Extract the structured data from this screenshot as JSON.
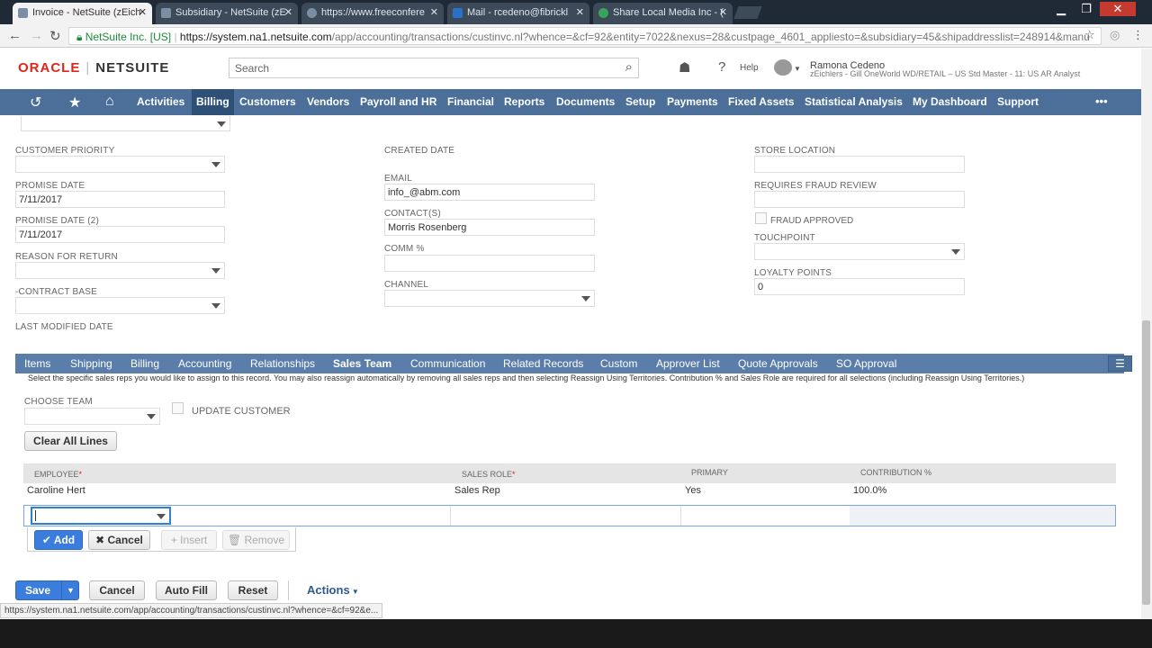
{
  "browser": {
    "tabs": [
      {
        "title": "Invoice - NetSuite (zEich",
        "active": true
      },
      {
        "title": "Subsidiary - NetSuite (zE",
        "active": false
      },
      {
        "title": "https://www.freeconfere",
        "active": false
      },
      {
        "title": "Mail - rcedeno@fibrickl",
        "active": false
      },
      {
        "title": "Share Local Media Inc - (",
        "active": false
      }
    ],
    "url_org": "NetSuite Inc. [US]",
    "url_host": "https://system.na1.netsuite.com",
    "url_path": "/app/accounting/transactions/custinvc.nl?whence=&cf=92&entity=7022&nexus=28&custpage_4601_appliesto=&subsidiary=45&shipaddresslist=248914&manu",
    "status_url": "https://system.na1.netsuite.com/app/accounting/transactions/custinvc.nl?whence=&cf=92&e..."
  },
  "header": {
    "logo_oracle": "ORACLE",
    "logo_netsuite": "NETSUITE",
    "search_placeholder": "Search",
    "help_label": "Help",
    "user_name": "Ramona Cedeno",
    "user_role": "zEichlers - Gill OneWorld WD/RETAIL – US Std Master - 11: US AR Analyst"
  },
  "nav": {
    "items": [
      "Activities",
      "Billing",
      "Customers",
      "Vendors",
      "Payroll and HR",
      "Financial",
      "Reports",
      "Documents",
      "Setup",
      "Payments",
      "Fixed Assets",
      "Statistical Analysis",
      "My Dashboard",
      "Support"
    ],
    "selected": "Billing",
    "more": "•••"
  },
  "form": {
    "col1": {
      "customer_priority": "CUSTOMER PRIORITY",
      "promise_date_label": "PROMISE DATE",
      "promise_date_value": "7/11/2017",
      "promise_date2_label": "PROMISE DATE (2)",
      "promise_date2_value": "7/11/2017",
      "reason_for_return": "REASON FOR RETURN",
      "contract_base": "-CONTRACT BASE",
      "last_modified": "LAST MODIFIED DATE"
    },
    "col2": {
      "created_date": "CREATED DATE",
      "email_label": "EMAIL",
      "email_value": "info_@abm.com",
      "contacts_label": "CONTACT(S)",
      "contacts_value": "Morris Rosenberg",
      "comm_label": "COMM %",
      "channel_label": "CHANNEL"
    },
    "col3": {
      "store_location": "STORE LOCATION",
      "requires_fraud": "REQUIRES FRAUD REVIEW",
      "fraud_approved": "FRAUD APPROVED",
      "touchpoint": "TOUCHPOINT",
      "loyalty_label": "LOYALTY POINTS",
      "loyalty_value": "0"
    }
  },
  "subtabs": {
    "items": [
      "Items",
      "Shipping",
      "Billing",
      "Accounting",
      "Relationships",
      "Sales Team",
      "Communication",
      "Related Records",
      "Custom",
      "Approver List",
      "Quote Approvals",
      "SO Approval"
    ],
    "selected": "Sales Team",
    "menu_icon": "list-icon"
  },
  "sales_team": {
    "help_text": "Select the specific sales reps you would like to assign to this record. You may also reassign automatically by removing all sales reps and then selecting Reassign Using Territories. Contribution % and Sales Role are required for all selections (including Reassign Using Territories.)",
    "choose_team": "CHOOSE TEAM",
    "update_customer": "UPDATE CUSTOMER",
    "clear_all": "Clear All Lines",
    "columns": {
      "employee": "EMPLOYEE",
      "sales_role": "SALES ROLE",
      "primary": "PRIMARY",
      "contribution": "CONTRIBUTION %"
    },
    "rows": [
      {
        "employee": "Caroline Hert",
        "sales_role": "Sales Rep",
        "primary": "Yes",
        "contribution": "100.0%"
      }
    ],
    "row_buttons": {
      "add": "Add",
      "cancel": "Cancel",
      "insert": "Insert",
      "remove": "Remove"
    }
  },
  "bottom_buttons": {
    "save": "Save",
    "cancel": "Cancel",
    "auto_fill": "Auto Fill",
    "reset": "Reset",
    "actions": "Actions"
  },
  "colors": {
    "nav": "#4c6f99",
    "subtabs": "#5a7ea9",
    "accent_blue": "#3b7ddc",
    "oracle_red": "#e0261a"
  }
}
